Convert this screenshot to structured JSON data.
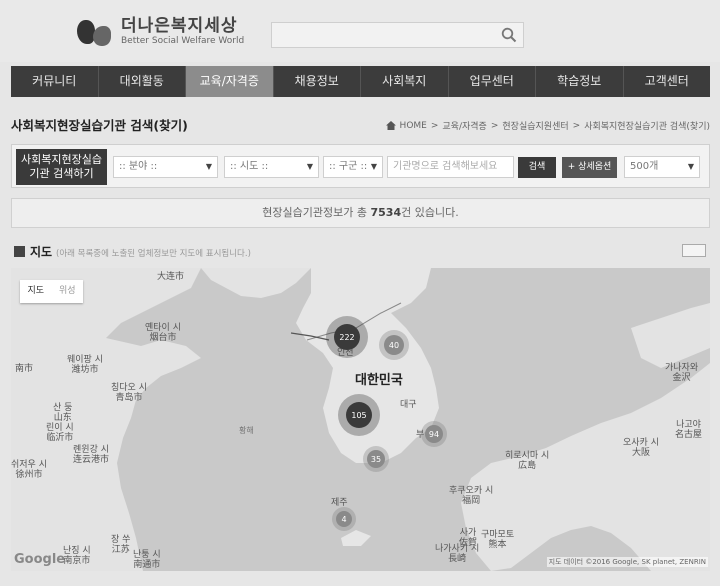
{
  "logo": {
    "title": "더나은복지세상",
    "subtitle": "Better Social Welfare World"
  },
  "nav": [
    {
      "label": "커뮤니티"
    },
    {
      "label": "대외활동"
    },
    {
      "label": "교육/자격증"
    },
    {
      "label": "채용정보"
    },
    {
      "label": "사회복지"
    },
    {
      "label": "업무센터"
    },
    {
      "label": "학습정보"
    },
    {
      "label": "고객센터"
    }
  ],
  "page": {
    "title": "사회복지현장실습기관 검색(찾기)"
  },
  "breadcrumb": [
    "HOME",
    ">",
    "교육/자격증",
    ">",
    "현장실습지원센터",
    ">",
    "사회복지현장실습기관 검색(찾기)"
  ],
  "filter": {
    "label_line1": "사회복지현장실습",
    "label_line2": "기관 검색하기",
    "field": ":: 분야 ::",
    "region": ":: 시도 ::",
    "district": ":: 구군 ::",
    "keyword_placeholder": "기관명으로 검색해보세요",
    "search_label": "검색",
    "advanced_label": "+ 상세옵션",
    "page_size": "500개"
  },
  "info": {
    "prefix": "현장실습기관정보가 총 ",
    "count": "7534",
    "suffix": "건 있습니다."
  },
  "map_section": {
    "title": "지도",
    "note": "(아래 목록중에 노출된 업체정보만 지도에 표시됩니다.)"
  },
  "map": {
    "type_map": "지도",
    "type_satellite": "위성",
    "country_label": "대한민국",
    "labels": {
      "dalian": "大连市",
      "yantai_ko": "옌타이 시",
      "yantai_cn": "烟台市",
      "weifang_ko": "웨이팡 시",
      "weifang_cn": "潍坊市",
      "qingdao_ko": "칭다오 시",
      "qingdao_cn": "青岛市",
      "shandong_ko": "산 둥",
      "shandong_cn": "山东",
      "linyi_ko": "린이 시",
      "linyi_cn": "临沂市",
      "lianyungang_ko": "롄윈강 시",
      "lianyungang_cn": "连云港市",
      "xuzhou_ko": "쉬저우 시",
      "xuzhou_cn": "徐州市",
      "jiangsu_ko": "장 쑤",
      "jiangsu_cn": "江苏",
      "nanjing_ko": "난징 시",
      "nanjing_cn": "南京市",
      "nantong_ko": "난퉁 시",
      "nantong_cn": "南通市",
      "hai_nan": "南市",
      "yellow_sea": "황해",
      "incheon": "인천",
      "daegu": "대구",
      "busan": "부",
      "jeju": "제주",
      "hiroshima_ko": "히로시마 시",
      "hiroshima_jp": "広島",
      "fukuoka_ko": "후쿠오카 시",
      "fukuoka_jp": "福岡",
      "kumamoto_ko": "구마모토",
      "kumamoto_jp": "熊本",
      "saga_ko": "사가",
      "saga_jp": "佐賀",
      "nagasaki_ko": "나가사키 시",
      "nagasaki_jp": "長崎",
      "osaka_ko": "오사카 시",
      "osaka_jp": "大阪",
      "nagoya_ko": "나고야",
      "nagoya_jp": "名古屋",
      "kanazawa_ko": "가나자와",
      "kanazawa_jp": "金沢"
    },
    "clusters": [
      {
        "value": "222"
      },
      {
        "value": "40"
      },
      {
        "value": "105"
      },
      {
        "value": "94"
      },
      {
        "value": "35"
      },
      {
        "value": "4"
      }
    ],
    "google": "Google",
    "copyright": "지도 데이터 ©2016 Google, SK planet, ZENRIN"
  },
  "colors": {
    "nav_bg": "#3c3c3c",
    "nav_active": "#8c8c8c",
    "cluster_dark": "#3a3a3a",
    "cluster_mid": "#888888"
  }
}
